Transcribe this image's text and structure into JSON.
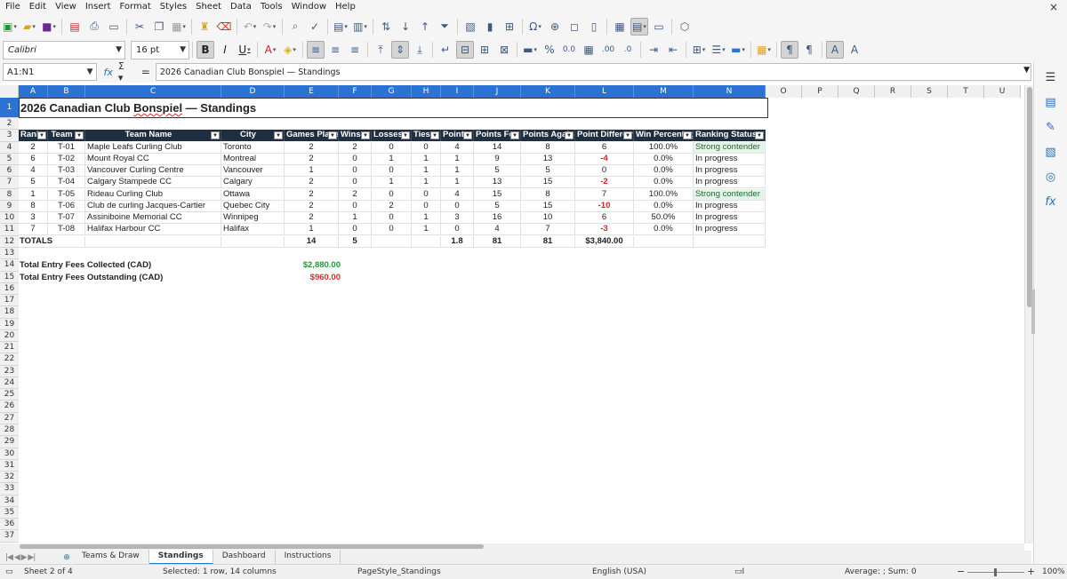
{
  "menu": [
    "File",
    "Edit",
    "View",
    "Insert",
    "Format",
    "Styles",
    "Sheet",
    "Data",
    "Tools",
    "Window",
    "Help"
  ],
  "close_glyph": "×",
  "font": {
    "name": "Calibri",
    "size": "16 pt"
  },
  "formula_bar": {
    "name_box": "A1:N1",
    "content": "2026 Canadian Club Bonspiel — Standings"
  },
  "sheet": {
    "title_pre": "2026 Canadian Club ",
    "title_misspelled": "Bonspiel",
    "title_post": " — Standings",
    "columns": [
      "A",
      "B",
      "C",
      "D",
      "E",
      "F",
      "G",
      "H",
      "I",
      "J",
      "K",
      "L",
      "M",
      "N",
      "O",
      "P",
      "Q",
      "R",
      "S",
      "T",
      "U"
    ],
    "row_numbers": [
      "1",
      "2",
      "3",
      "4",
      "5",
      "6",
      "7",
      "8",
      "9",
      "10",
      "11",
      "12",
      "13",
      "14",
      "15",
      "16",
      "17",
      "18",
      "19",
      "20",
      "21",
      "22",
      "23",
      "24",
      "25",
      "26",
      "27",
      "28",
      "29",
      "30",
      "31",
      "32",
      "33",
      "34",
      "35",
      "36",
      "37"
    ],
    "headers": [
      "Rank",
      "Team",
      "Team Name",
      "City",
      "Games Played",
      "Wins",
      "Losses",
      "Ties",
      "Points",
      "Points For",
      "Points Against",
      "Point Differential",
      "Win Percentage",
      "Ranking Status"
    ],
    "rows": [
      [
        "2",
        "T-01",
        "Maple Leafs Curling Club",
        "Toronto",
        "2",
        "2",
        "0",
        "0",
        "4",
        "14",
        "8",
        "6",
        "100.0%",
        "Strong contender"
      ],
      [
        "6",
        "T-02",
        "Mount Royal CC",
        "Montreal",
        "2",
        "0",
        "1",
        "1",
        "1",
        "9",
        "13",
        "-4",
        "0.0%",
        "In progress"
      ],
      [
        "4",
        "T-03",
        "Vancouver Curling Centre",
        "Vancouver",
        "1",
        "0",
        "0",
        "1",
        "1",
        "5",
        "5",
        "0",
        "0.0%",
        "In progress"
      ],
      [
        "5",
        "T-04",
        "Calgary Stampede CC",
        "Calgary",
        "2",
        "0",
        "1",
        "1",
        "1",
        "13",
        "15",
        "-2",
        "0.0%",
        "In progress"
      ],
      [
        "1",
        "T-05",
        "Rideau Curling Club",
        "Ottawa",
        "2",
        "2",
        "0",
        "0",
        "4",
        "15",
        "8",
        "7",
        "100.0%",
        "Strong contender"
      ],
      [
        "8",
        "T-06",
        "Club de curling Jacques-Cartier",
        "Quebec City",
        "2",
        "0",
        "2",
        "0",
        "0",
        "5",
        "15",
        "-10",
        "0.0%",
        "In progress"
      ],
      [
        "3",
        "T-07",
        "Assiniboine Memorial CC",
        "Winnipeg",
        "2",
        "1",
        "0",
        "1",
        "3",
        "16",
        "10",
        "6",
        "50.0%",
        "In progress"
      ],
      [
        "7",
        "T-08",
        "Halifax Harbour CC",
        "Halifax",
        "1",
        "0",
        "0",
        "1",
        "0",
        "4",
        "7",
        "-3",
        "0.0%",
        "In progress"
      ]
    ],
    "totals": {
      "label": "TOTALS",
      "games_played": "14",
      "wins": "5",
      "points": "1.8",
      "points_for": "81",
      "points_against": "81",
      "point_differential": "$3,840.00"
    },
    "fees": [
      {
        "label": "Total Entry Fees Collected (CAD)",
        "value": "$2,880.00",
        "color": "#1e9a3c"
      },
      {
        "label": "Total Entry Fees Outstanding (CAD)",
        "value": "$960.00",
        "color": "#d32f2f"
      }
    ]
  },
  "tabs": [
    "Teams & Draw",
    "Standings",
    "Dashboard",
    "Instructions"
  ],
  "active_tab": "Standings",
  "status": {
    "sheet": "Sheet 2 of 4",
    "selection": "Selected: 1 row, 14 columns",
    "page_style": "PageStyle_Standings",
    "language": "English (USA)",
    "sum": "Average: ; Sum: 0",
    "zoom": "100%",
    "zoom_minus": "−",
    "zoom_plus": "+"
  },
  "colors": {
    "accent": "#2a72d4",
    "header_bg": "#1f2e40",
    "negative": "#c62828",
    "contender_bg": "#e5f4e9"
  }
}
